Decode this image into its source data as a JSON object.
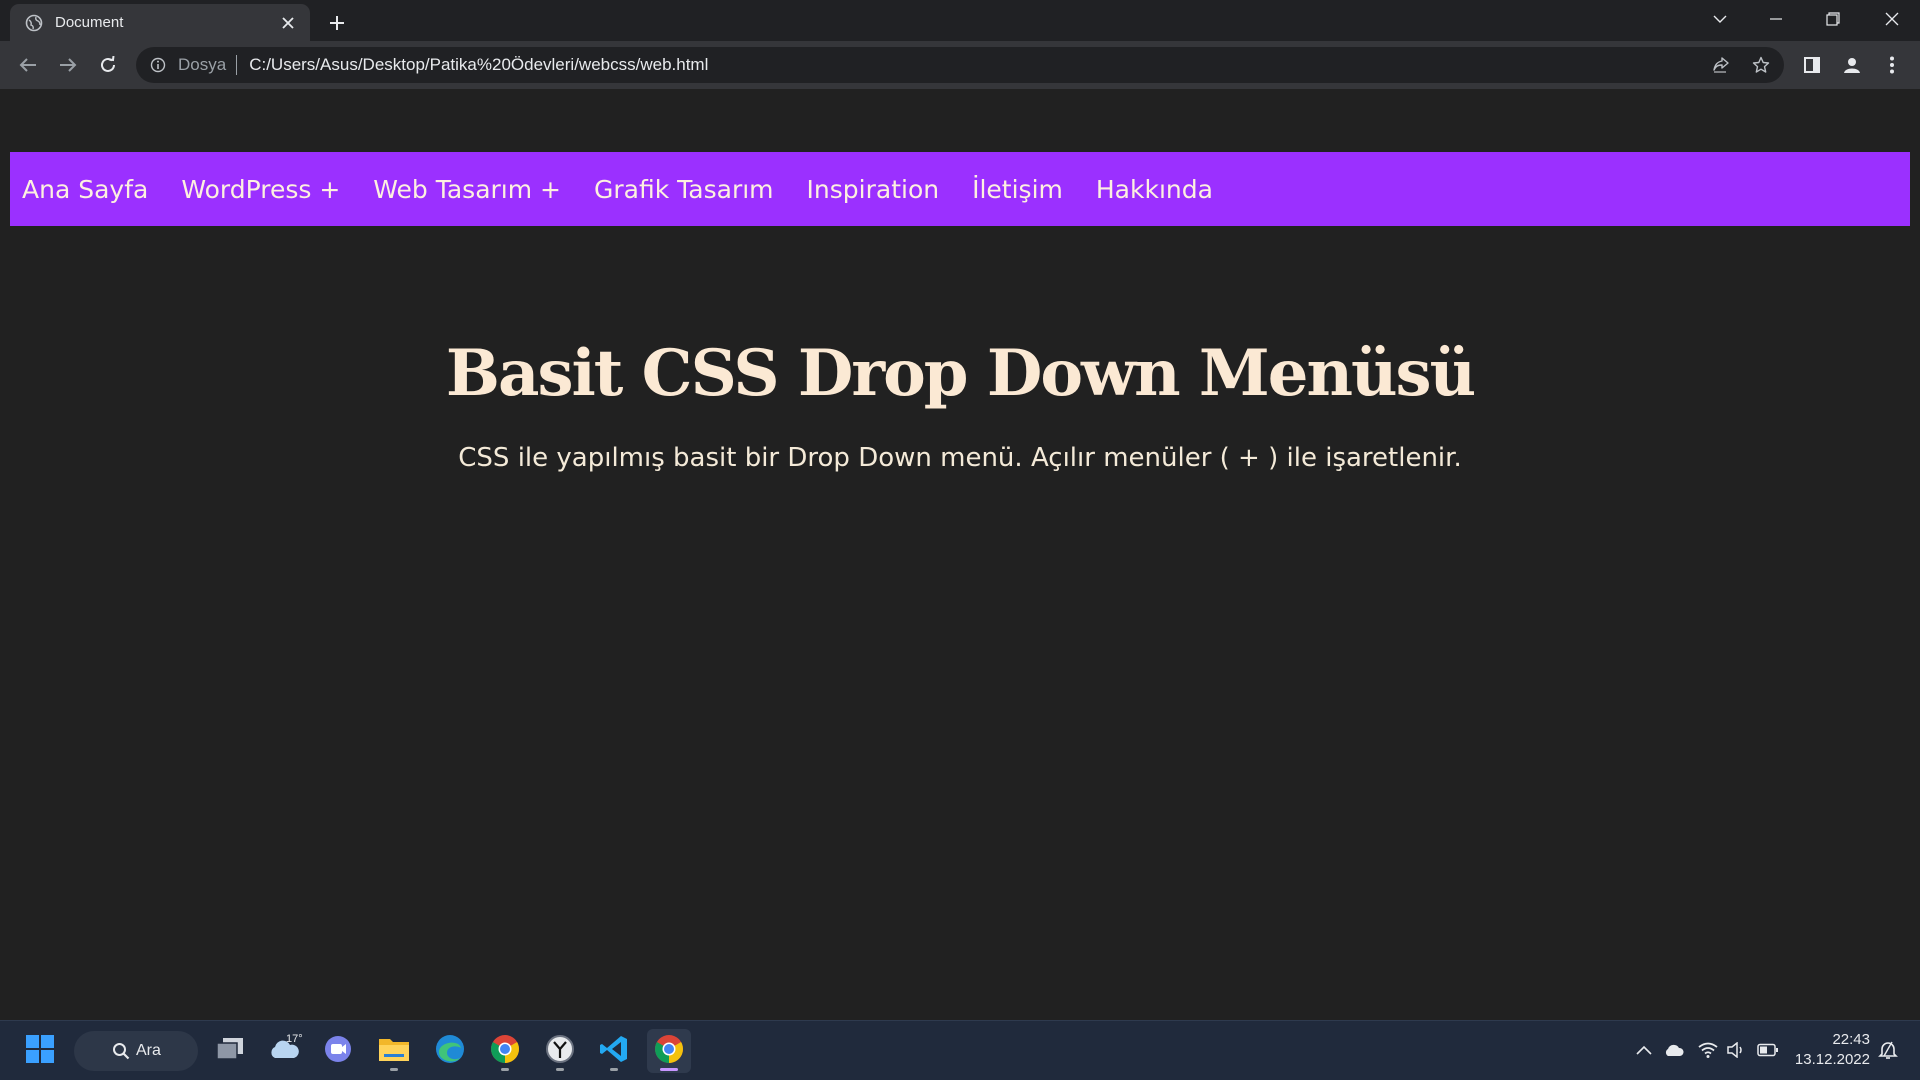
{
  "browser": {
    "tab_title": "Document",
    "omnibox": {
      "security_chip": "Dosya",
      "url": "C:/Users/Asus/Desktop/Patika%20Ödevleri/webcss/web.html"
    }
  },
  "page": {
    "menu": {
      "items": [
        {
          "label": "Ana Sayfa"
        },
        {
          "label": "WordPress +"
        },
        {
          "label": "Web Tasarım +"
        },
        {
          "label": "Grafik Tasarım"
        },
        {
          "label": "Inspiration"
        },
        {
          "label": "İletişim"
        },
        {
          "label": "Hakkında"
        }
      ]
    },
    "title": "Basit CSS Drop Down Menüsü",
    "subtitle": "CSS ile yapılmış basit bir Drop Down menü. Açılır menüler ( + ) ile işaretlenir."
  },
  "taskbar": {
    "search_label": "Ara",
    "weather_temp": "17°",
    "time": "22:43",
    "date": "13.12.2022"
  },
  "colors": {
    "menu_bg": "#9b30ff",
    "page_bg": "#212121",
    "title_color": "#fbe9d4"
  }
}
